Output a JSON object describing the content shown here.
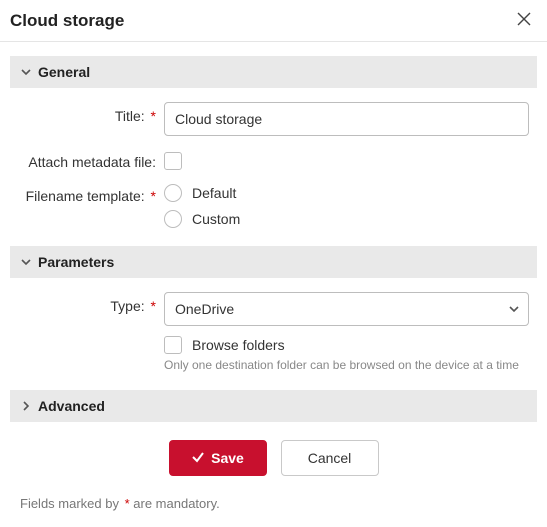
{
  "header": {
    "title": "Cloud storage"
  },
  "sections": {
    "general": {
      "title": "General",
      "title_label": "Title:",
      "title_value": "Cloud storage",
      "attach_metadata_label": "Attach metadata file:",
      "filename_template_label": "Filename template:",
      "radio_default": "Default",
      "radio_custom": "Custom"
    },
    "parameters": {
      "title": "Parameters",
      "type_label": "Type:",
      "type_value": "OneDrive",
      "browse_folders_label": "Browse folders",
      "browse_hint": "Only one destination folder can be browsed on the device at a time"
    },
    "advanced": {
      "title": "Advanced"
    }
  },
  "footer": {
    "save": "Save",
    "cancel": "Cancel",
    "mandatory_prefix": "Fields marked by ",
    "mandatory_suffix": " are mandatory."
  },
  "asterisk": "*"
}
